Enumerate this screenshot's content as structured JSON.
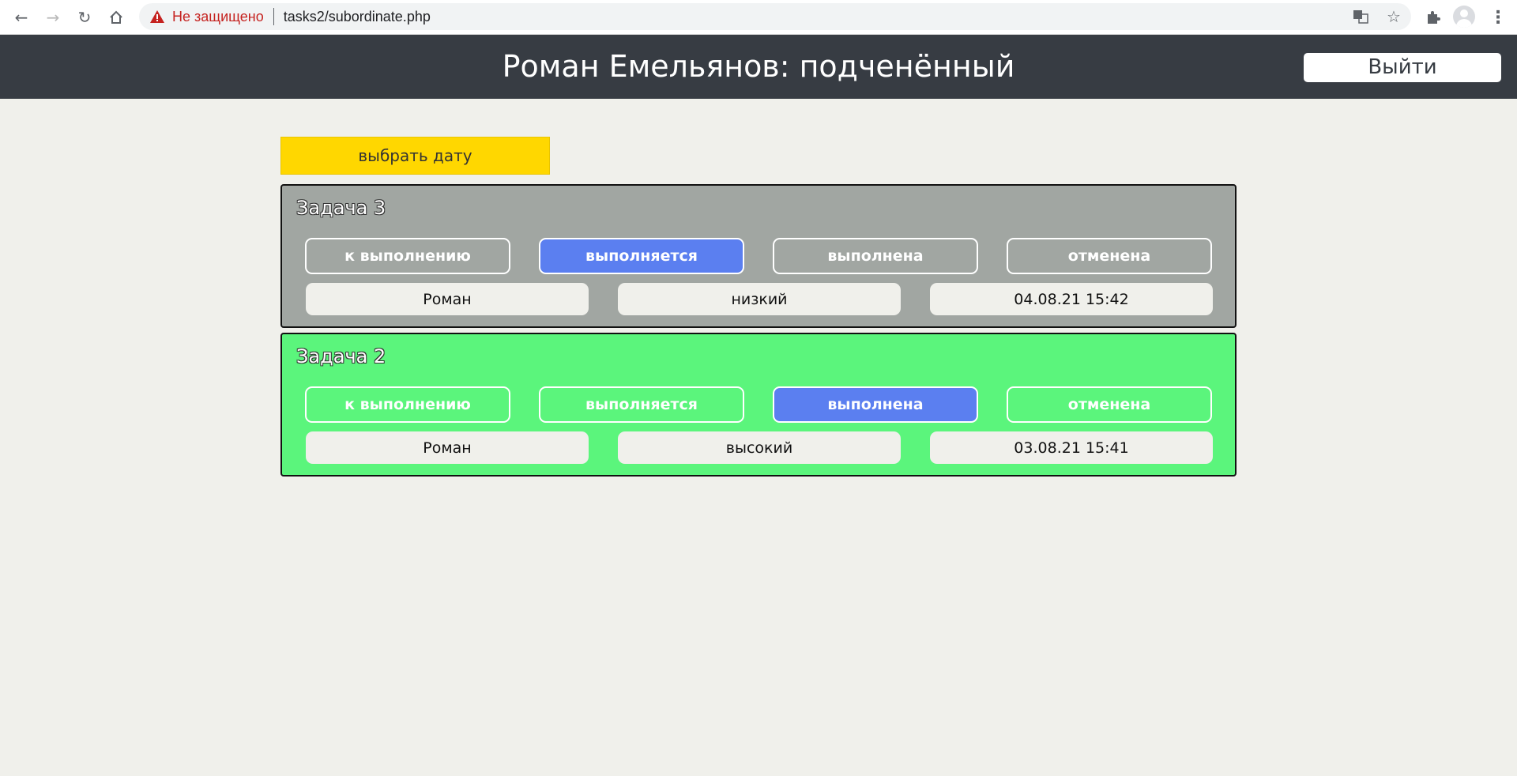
{
  "browser": {
    "insecure_label": "Не защищено",
    "url": "tasks2/subordinate.php"
  },
  "header": {
    "title": "Роман Емельянов: подченённый",
    "logout_label": "Выйти"
  },
  "date_picker": {
    "label": "выбрать дату"
  },
  "colors": {
    "header_bg": "#373c43",
    "date_button": "#ffd700",
    "card_gray": "#a1a6a2",
    "card_green": "#5bf57c",
    "active_status": "#5b7ff0",
    "page_bg": "#f0f0eb"
  },
  "tasks": [
    {
      "title": "Задача 3",
      "statuses": [
        "к выполнению",
        "выполняется",
        "выполнена",
        "отменена"
      ],
      "active_status_index": 1,
      "assignee": "Роман",
      "priority": "низкий",
      "datetime": "04.08.21 15:42"
    },
    {
      "title": "Задача 2",
      "statuses": [
        "к выполнению",
        "выполняется",
        "выполнена",
        "отменена"
      ],
      "active_status_index": 2,
      "assignee": "Роман",
      "priority": "высокий",
      "datetime": "03.08.21 15:41"
    }
  ]
}
